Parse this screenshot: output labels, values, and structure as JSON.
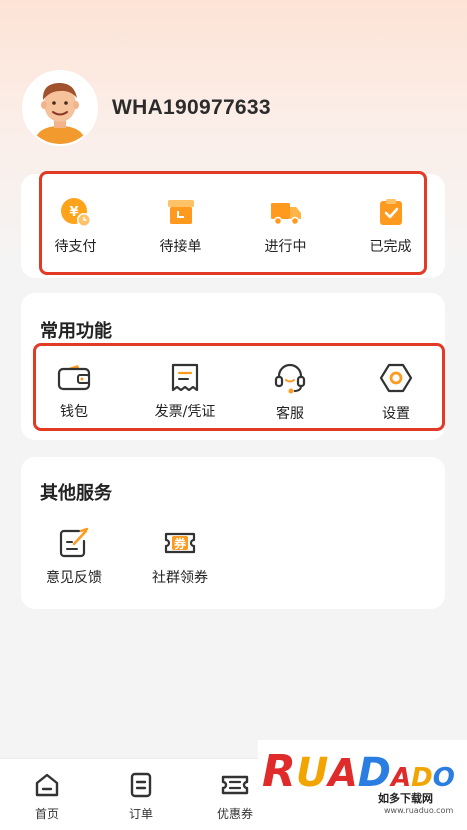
{
  "profile": {
    "username": "WHA190977633",
    "avatar_icon": "avatar-icon"
  },
  "orders": {
    "items": [
      {
        "label": "待支付",
        "icon": "wallet-coin-icon"
      },
      {
        "label": "待接单",
        "icon": "box-clock-icon"
      },
      {
        "label": "进行中",
        "icon": "truck-icon"
      },
      {
        "label": "已完成",
        "icon": "clipboard-check-icon"
      }
    ]
  },
  "common": {
    "title": "常用功能",
    "items": [
      {
        "label": "钱包",
        "icon": "wallet-icon"
      },
      {
        "label": "发票/凭证",
        "icon": "receipt-icon"
      },
      {
        "label": "客服",
        "icon": "headset-icon"
      },
      {
        "label": "设置",
        "icon": "settings-hex-icon"
      }
    ]
  },
  "other": {
    "title": "其他服务",
    "items": [
      {
        "label": "意见反馈",
        "icon": "feedback-icon"
      },
      {
        "label": "社群领券",
        "icon": "coupon-icon"
      }
    ],
    "coupon_glyph": "券"
  },
  "tabbar": {
    "items": [
      {
        "label": "首页",
        "icon": "home-icon"
      },
      {
        "label": "订单",
        "icon": "order-icon"
      },
      {
        "label": "优惠券",
        "icon": "coupon-tab-icon"
      }
    ]
  },
  "watermark": {
    "letters": [
      "R",
      "U",
      "A",
      "D",
      "A",
      "D",
      "O"
    ],
    "subtitle": "如多下载网",
    "url": "www.ruaduo.com"
  },
  "colors": {
    "accent": "#ff9a1f",
    "highlight_border": "#e13b26"
  }
}
